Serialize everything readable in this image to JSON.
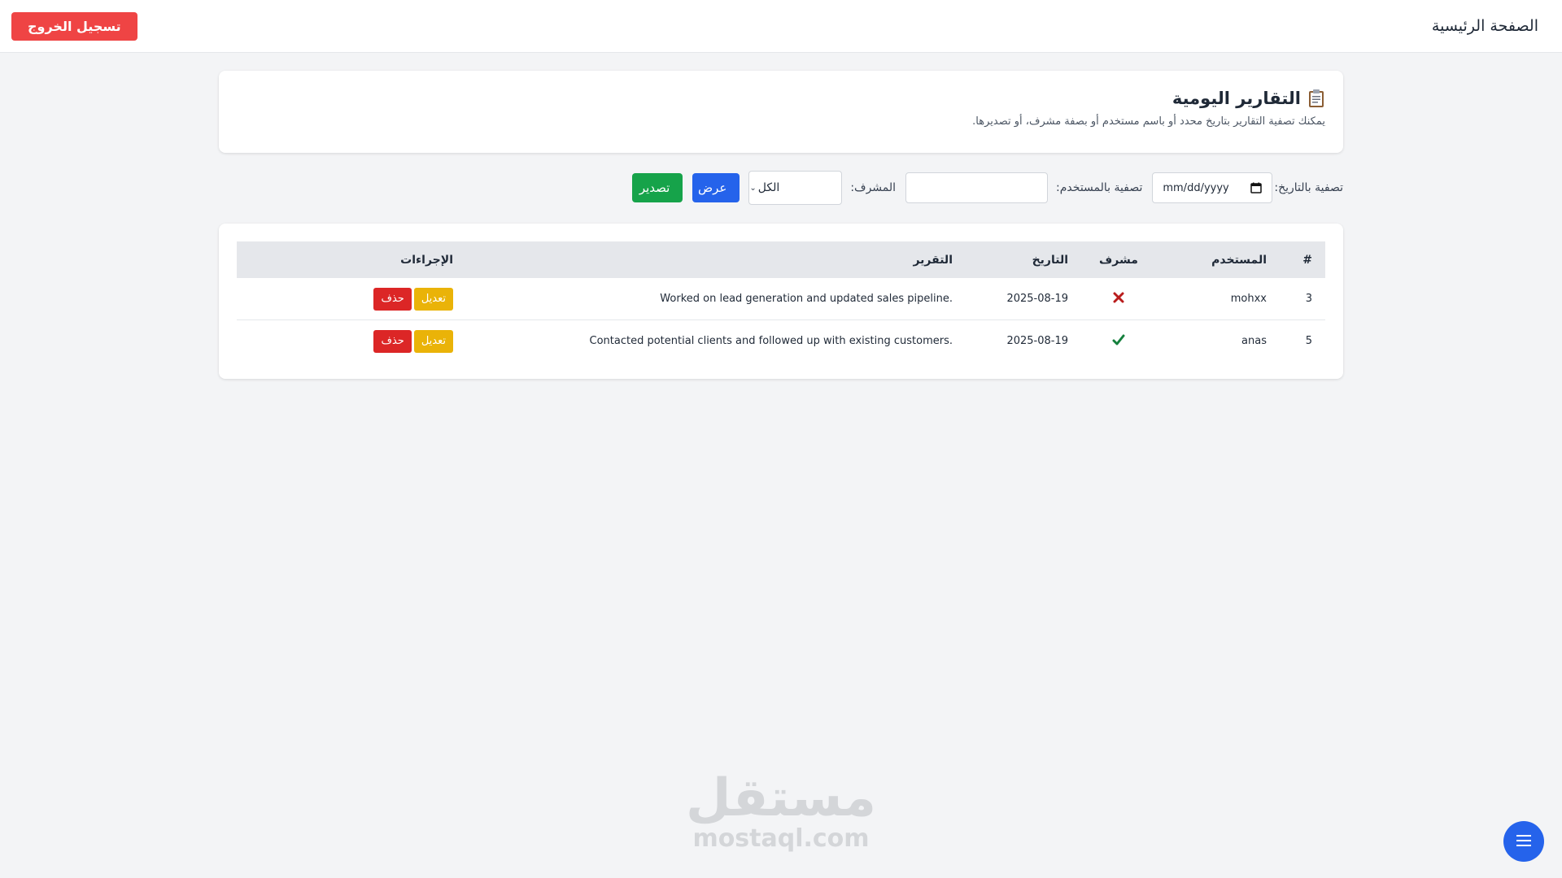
{
  "nav": {
    "home_label": "الصفحة الرئيسية",
    "logout_label": "تسجيل الخروج"
  },
  "header": {
    "title": "التقارير اليومية",
    "icon": "clipboard-icon",
    "description": "يمكنك تصفية التقارير بتاريخ محدد أو باسم مستخدم أو بصفة مشرف، أو تصديرها."
  },
  "filters": {
    "date_label": "تصفية بالتاريخ:",
    "date_placeholder": "mm/dd/yyyy",
    "user_label": "تصفية بالمستخدم:",
    "user_value": "",
    "supervisor_label": "المشرف:",
    "supervisor_selected": "الكل",
    "view_label": "عرض",
    "export_label": "تصدير"
  },
  "table": {
    "headers": {
      "num": "#",
      "user": "المستخدم",
      "supervisor": "مشرف",
      "date": "التاريخ",
      "report": "التقرير",
      "actions": "الإجراءات"
    },
    "rows": [
      {
        "num": "3",
        "user": "mohxx",
        "supervisor": false,
        "date": "2025-08-19",
        "report": "Worked on lead generation and updated sales pipeline.",
        "edit_label": "تعديل",
        "delete_label": "حذف"
      },
      {
        "num": "5",
        "user": "anas",
        "supervisor": true,
        "date": "2025-08-19",
        "report": "Contacted potential clients and followed up with existing customers.",
        "edit_label": "تعديل",
        "delete_label": "حذف"
      }
    ]
  },
  "watermark": {
    "arabic": "مستقل",
    "latin": "mostaql.com"
  },
  "colors": {
    "danger": "#ef4444",
    "primary": "#2563eb",
    "success": "#16a34a",
    "warning": "#eab308",
    "check": "#15803d",
    "cross": "#b91c1c"
  }
}
